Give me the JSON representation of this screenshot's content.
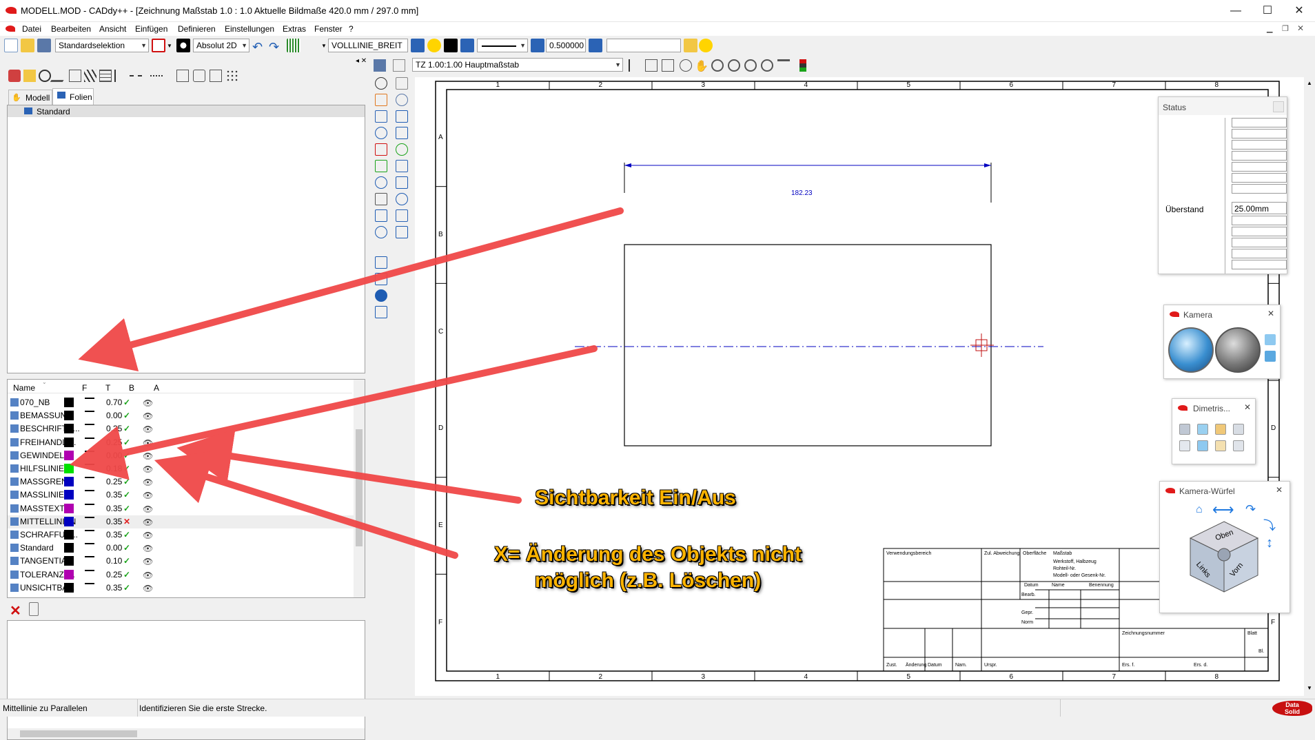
{
  "window": {
    "title": "MODELL.MOD  -  CADdy++ - [Zeichnung   Maßstab 1.0 : 1.0   Aktuelle Bildmaße 420.0 mm / 297.0 mm]",
    "minimize": "—",
    "maximize": "☐",
    "close": "✕"
  },
  "menu": [
    "Datei",
    "Bearbeiten",
    "Ansicht",
    "Einfügen",
    "Definieren",
    "Einstellungen",
    "Extras",
    "Fenster",
    "?"
  ],
  "toolbar": {
    "selection": "Standardselektion",
    "coord_mode": "Absolut 2D",
    "linetype": "VOLLLINIE_BREIT",
    "width_value": "0.500000",
    "layer_value": ""
  },
  "viewbar": {
    "scale_zone": "TZ 1.00:1.00 Hauptmaßstab"
  },
  "left_panel": {
    "tabs": [
      "Modell",
      "Folien"
    ],
    "tree_root": "Standard",
    "layer_headers": [
      "Name",
      "F",
      "T",
      "B",
      "A"
    ],
    "layers": [
      {
        "name": "070_NB",
        "color": "#000000",
        "width": "0.70",
        "editable": "ok"
      },
      {
        "name": "BEMASSUN...",
        "color": "#000000",
        "width": "0.00",
        "editable": "ok"
      },
      {
        "name": "BESCHRIFTU...",
        "color": "#000000",
        "width": "0.35",
        "editable": "ok"
      },
      {
        "name": "FREIHANDLI...",
        "color": "#000000",
        "width": "0.25",
        "editable": "ok"
      },
      {
        "name": "GEWINDELI...",
        "color": "#b000b0",
        "width": "0.00",
        "editable": "ok"
      },
      {
        "name": "HILFSLINIEN",
        "color": "#00e000",
        "width": "0.18",
        "editable": "ok"
      },
      {
        "name": "MASSGREN...",
        "color": "#0000c0",
        "width": "0.25",
        "editable": "ok"
      },
      {
        "name": "MASSLINIEN",
        "color": "#0000c0",
        "width": "0.35",
        "editable": "ok"
      },
      {
        "name": "MASSTEXTE",
        "color": "#b000b0",
        "width": "0.35",
        "editable": "ok"
      },
      {
        "name": "MITTELLINIEN",
        "color": "#0000c0",
        "width": "0.35",
        "editable": "locked"
      },
      {
        "name": "SCHRAFFUR...",
        "color": "#000000",
        "width": "0.35",
        "editable": "ok"
      },
      {
        "name": "Standard",
        "color": "#000000",
        "width": "0.00",
        "editable": "ok"
      },
      {
        "name": "TANGENTIA...",
        "color": "#000000",
        "width": "0.10",
        "editable": "ok"
      },
      {
        "name": "TOLERANZT...",
        "color": "#b000b0",
        "width": "0.25",
        "editable": "ok"
      },
      {
        "name": "UNSICHTBA...",
        "color": "#000000",
        "width": "0.35",
        "editable": "ok"
      }
    ],
    "check_glyph": "✓",
    "cross_glyph": "✕",
    "eye_glyph": "👁"
  },
  "drawing": {
    "dimension_text": "182.23",
    "ruler_cols": [
      "1",
      "2",
      "3",
      "4",
      "5",
      "6",
      "7",
      "8"
    ],
    "ruler_rows": [
      "A",
      "B",
      "C",
      "D",
      "E",
      "F"
    ],
    "title_block": {
      "verwendungsbereich": "Verwendungsbereich",
      "zul_abweichung": "Zul. Abweichung",
      "oberflaeche": "Oberfläche",
      "massstab": "Maßstab",
      "werkstoff": "Werkstoff, Halbzeug",
      "rohteil": "Rohteil-Nr.",
      "modell": "Modell- oder Gesenk-Nr.",
      "datum": "Datum",
      "name": "Name",
      "benennung": "Benennung",
      "bearb": "Bearb.",
      "gepr": "Gepr.",
      "norm": "Norm",
      "zeichnungsnummer": "Zeichnungsnummer",
      "blatt": "Blatt",
      "bl": "Bl.",
      "zust": "Zust.",
      "aenderung": "Änderung",
      "datum2": "Datum",
      "nam": "Nam.",
      "urspr": "Urspr.",
      "ers_f": "Ers. f.",
      "ers_d": "Ers. d."
    }
  },
  "callouts": {
    "visibility": "Sichtbarkeit Ein/Aus",
    "lock_line1": "X= Änderung des Objekts nicht",
    "lock_line2": "möglich (z.B. Löschen)"
  },
  "status_panel": {
    "title": "Status",
    "ueberstand_label": "Überstand",
    "ueberstand_value": "25.00mm"
  },
  "kamera_panel": {
    "title": "Kamera"
  },
  "dimetric_panel": {
    "title": "Dimetris..."
  },
  "cube_panel": {
    "title": "Kamera-Würfel",
    "face_top": "Oben",
    "face_left": "Links",
    "face_front": "Vorn"
  },
  "statusbar": {
    "left": "Mittellinie zu Parallelen",
    "message": "Identifizieren Sie die erste Strecke."
  },
  "brand": {
    "logo_line1": "Data",
    "logo_line2": "Solid"
  }
}
